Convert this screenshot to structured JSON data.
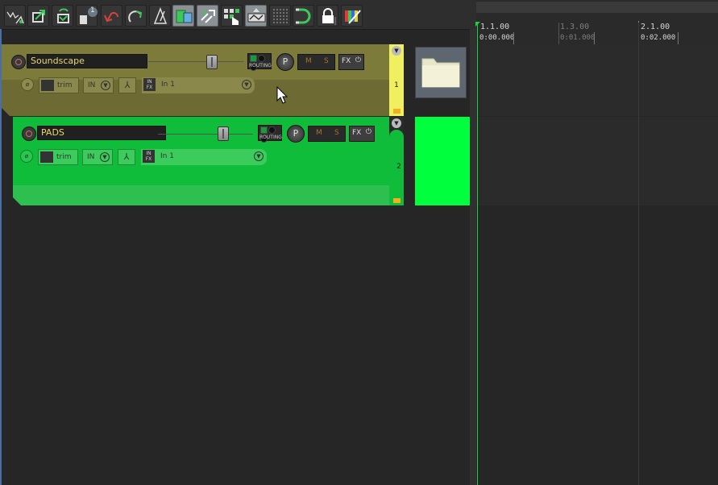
{
  "toolbar": {
    "buttons": [
      {
        "icon": "envelope-tool-icon"
      },
      {
        "icon": "ripple-edit-icon"
      },
      {
        "icon": "render-item-icon"
      },
      {
        "icon": "item-count-icon",
        "badge": "1"
      },
      {
        "icon": "undo-arrow-icon"
      },
      {
        "icon": "redo-arrow-icon"
      },
      {
        "icon": "metronome-icon"
      },
      {
        "icon": "snap-icon"
      },
      {
        "icon": "link-icon"
      },
      {
        "icon": "grid-cursor-icon"
      },
      {
        "icon": "crossfade-icon"
      },
      {
        "icon": "grid-lines-icon"
      },
      {
        "icon": "magnet-icon"
      },
      {
        "icon": "lock-icon"
      },
      {
        "icon": "color-picker-icon"
      }
    ]
  },
  "tracks": [
    {
      "name": "Soundscape",
      "number": "1",
      "routing_label": "ROUTING",
      "pan_label": "P",
      "mute_label": "M",
      "solo_label": "S",
      "fx_label": "FX",
      "power_label": "⏻",
      "env_label": "trim",
      "input_label": "IN",
      "infx_label": "IN FX",
      "input_value": "In 1",
      "color": "#7d7b3a"
    },
    {
      "name": "PADS",
      "number": "2",
      "routing_label": "ROUTING",
      "pan_label": "P",
      "mute_label": "M",
      "solo_label": "S",
      "fx_label": "FX",
      "power_label": "⏻",
      "env_label": "trim",
      "input_label": "IN",
      "infx_label": "IN FX",
      "input_value": "In 1",
      "color": "#0fbd3a"
    }
  ],
  "ruler": {
    "marks": [
      {
        "measure": "1.1.00",
        "time": "0:00.000"
      },
      {
        "measure": "1.3.00",
        "time": "0:01.000"
      },
      {
        "measure": "2.1.00",
        "time": "0:02.000"
      }
    ]
  },
  "colors": {
    "accent_green": "#00ff3c",
    "cursor": "#1bd43b"
  }
}
